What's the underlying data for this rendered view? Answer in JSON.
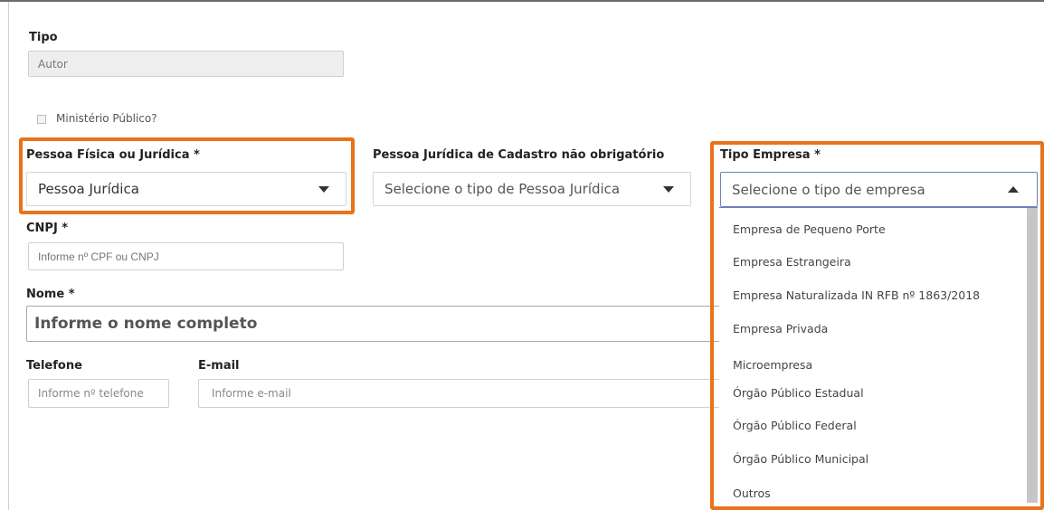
{
  "tipo": {
    "label": "Tipo",
    "value": "Autor"
  },
  "ministerio": {
    "label": "Ministério Público?",
    "checked": false
  },
  "pessoa": {
    "label": "Pessoa Física ou Jurídica *",
    "value": "Pessoa Jurídica"
  },
  "cadastro": {
    "label": "Pessoa Jurídica de Cadastro não obrigatório",
    "placeholder": "Selecione o tipo de Pessoa Jurídica"
  },
  "tipo_empresa": {
    "label": "Tipo Empresa *",
    "placeholder": "Selecione o tipo de empresa",
    "options": [
      "Empresa de Pequeno Porte",
      "Empresa Estrangeira",
      "Empresa Naturalizada IN RFB nº 1863/2018",
      "Empresa Privada",
      "Microempresa",
      "Órgão Público Estadual",
      "Órgão Público Federal",
      "Órgão Público Municipal",
      "Outros"
    ]
  },
  "cnpj": {
    "label": "CNPJ *",
    "placeholder": "Informe nº CPF ou CNPJ"
  },
  "nome": {
    "label": "Nome *",
    "placeholder": "Informe o nome completo"
  },
  "telefone": {
    "label": "Telefone",
    "placeholder": "Informe nº telefone"
  },
  "email": {
    "label": "E-mail",
    "placeholder": "Informe e-mail"
  },
  "colors": {
    "highlight": "#e8731b",
    "dropdown_border": "#6d80b8"
  }
}
